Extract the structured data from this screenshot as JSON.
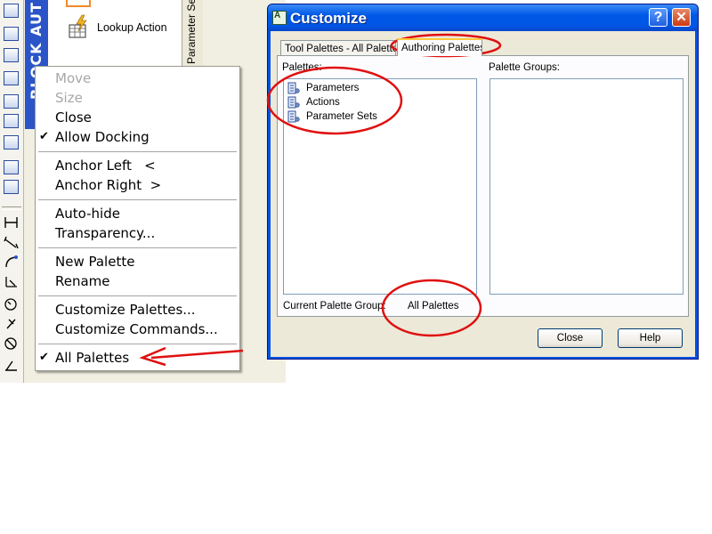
{
  "palette": {
    "block_bar_text": "BLOCK AUT",
    "lookup_action": "Lookup Action",
    "parameter_sets_tab": "Parameter Sets"
  },
  "context_menu": {
    "items": [
      {
        "label": "Move",
        "disabled": true,
        "checked": false
      },
      {
        "label": "Size",
        "disabled": true,
        "checked": false
      },
      {
        "label": "Close",
        "disabled": false,
        "checked": false
      },
      {
        "label": "Allow Docking",
        "disabled": false,
        "checked": true
      },
      {
        "label": "Anchor Left   <",
        "disabled": false,
        "checked": false
      },
      {
        "label": "Anchor Right  >",
        "disabled": false,
        "checked": false
      },
      {
        "label": "Auto-hide",
        "disabled": false,
        "checked": false
      },
      {
        "label": "Transparency...",
        "disabled": false,
        "checked": false
      },
      {
        "label": "New Palette",
        "disabled": false,
        "checked": false
      },
      {
        "label": "Rename",
        "disabled": false,
        "checked": false
      },
      {
        "label": "Customize Palettes...",
        "disabled": false,
        "checked": false
      },
      {
        "label": "Customize Commands...",
        "disabled": false,
        "checked": false
      },
      {
        "label": "All Palettes",
        "disabled": false,
        "checked": true
      }
    ],
    "check_glyph": "✔"
  },
  "dialog": {
    "title": "Customize",
    "help_glyph": "?",
    "close_glyph": "✕",
    "tabs": [
      "Tool Palettes - All Palettes",
      "Authoring Palettes"
    ],
    "active_tab": "Authoring Palettes",
    "palettes_label": "Palettes:",
    "palette_groups_label": "Palette Groups:",
    "palettes": [
      "Parameters",
      "Actions",
      "Parameter Sets"
    ],
    "current_group_label": "Current Palette Group:",
    "current_group_value": "All Palettes",
    "close_button": "Close",
    "help_button": "Help"
  },
  "colors": {
    "annotation_red": "#e01010",
    "title_blue": "#0055e5",
    "block_bar_blue": "#2a54c8"
  }
}
